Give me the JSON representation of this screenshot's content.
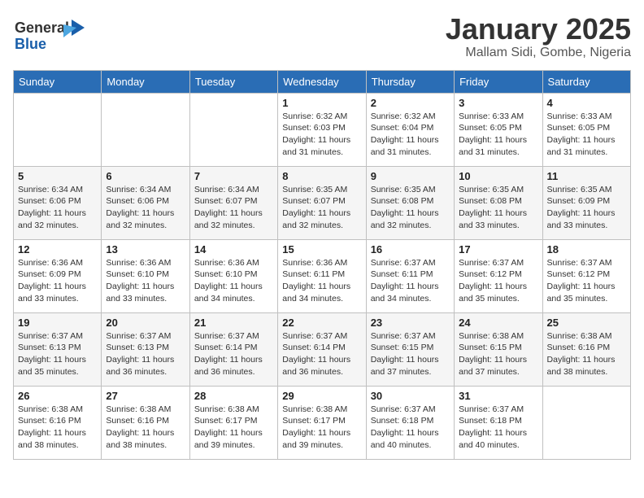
{
  "header": {
    "logo_general": "General",
    "logo_blue": "Blue",
    "month_title": "January 2025",
    "location": "Mallam Sidi, Gombe, Nigeria"
  },
  "weekdays": [
    "Sunday",
    "Monday",
    "Tuesday",
    "Wednesday",
    "Thursday",
    "Friday",
    "Saturday"
  ],
  "weeks": [
    [
      {
        "day": "",
        "sunrise": "",
        "sunset": "",
        "daylight": ""
      },
      {
        "day": "",
        "sunrise": "",
        "sunset": "",
        "daylight": ""
      },
      {
        "day": "",
        "sunrise": "",
        "sunset": "",
        "daylight": ""
      },
      {
        "day": "1",
        "sunrise": "Sunrise: 6:32 AM",
        "sunset": "Sunset: 6:03 PM",
        "daylight": "Daylight: 11 hours and 31 minutes."
      },
      {
        "day": "2",
        "sunrise": "Sunrise: 6:32 AM",
        "sunset": "Sunset: 6:04 PM",
        "daylight": "Daylight: 11 hours and 31 minutes."
      },
      {
        "day": "3",
        "sunrise": "Sunrise: 6:33 AM",
        "sunset": "Sunset: 6:05 PM",
        "daylight": "Daylight: 11 hours and 31 minutes."
      },
      {
        "day": "4",
        "sunrise": "Sunrise: 6:33 AM",
        "sunset": "Sunset: 6:05 PM",
        "daylight": "Daylight: 11 hours and 31 minutes."
      }
    ],
    [
      {
        "day": "5",
        "sunrise": "Sunrise: 6:34 AM",
        "sunset": "Sunset: 6:06 PM",
        "daylight": "Daylight: 11 hours and 32 minutes."
      },
      {
        "day": "6",
        "sunrise": "Sunrise: 6:34 AM",
        "sunset": "Sunset: 6:06 PM",
        "daylight": "Daylight: 11 hours and 32 minutes."
      },
      {
        "day": "7",
        "sunrise": "Sunrise: 6:34 AM",
        "sunset": "Sunset: 6:07 PM",
        "daylight": "Daylight: 11 hours and 32 minutes."
      },
      {
        "day": "8",
        "sunrise": "Sunrise: 6:35 AM",
        "sunset": "Sunset: 6:07 PM",
        "daylight": "Daylight: 11 hours and 32 minutes."
      },
      {
        "day": "9",
        "sunrise": "Sunrise: 6:35 AM",
        "sunset": "Sunset: 6:08 PM",
        "daylight": "Daylight: 11 hours and 32 minutes."
      },
      {
        "day": "10",
        "sunrise": "Sunrise: 6:35 AM",
        "sunset": "Sunset: 6:08 PM",
        "daylight": "Daylight: 11 hours and 33 minutes."
      },
      {
        "day": "11",
        "sunrise": "Sunrise: 6:35 AM",
        "sunset": "Sunset: 6:09 PM",
        "daylight": "Daylight: 11 hours and 33 minutes."
      }
    ],
    [
      {
        "day": "12",
        "sunrise": "Sunrise: 6:36 AM",
        "sunset": "Sunset: 6:09 PM",
        "daylight": "Daylight: 11 hours and 33 minutes."
      },
      {
        "day": "13",
        "sunrise": "Sunrise: 6:36 AM",
        "sunset": "Sunset: 6:10 PM",
        "daylight": "Daylight: 11 hours and 33 minutes."
      },
      {
        "day": "14",
        "sunrise": "Sunrise: 6:36 AM",
        "sunset": "Sunset: 6:10 PM",
        "daylight": "Daylight: 11 hours and 34 minutes."
      },
      {
        "day": "15",
        "sunrise": "Sunrise: 6:36 AM",
        "sunset": "Sunset: 6:11 PM",
        "daylight": "Daylight: 11 hours and 34 minutes."
      },
      {
        "day": "16",
        "sunrise": "Sunrise: 6:37 AM",
        "sunset": "Sunset: 6:11 PM",
        "daylight": "Daylight: 11 hours and 34 minutes."
      },
      {
        "day": "17",
        "sunrise": "Sunrise: 6:37 AM",
        "sunset": "Sunset: 6:12 PM",
        "daylight": "Daylight: 11 hours and 35 minutes."
      },
      {
        "day": "18",
        "sunrise": "Sunrise: 6:37 AM",
        "sunset": "Sunset: 6:12 PM",
        "daylight": "Daylight: 11 hours and 35 minutes."
      }
    ],
    [
      {
        "day": "19",
        "sunrise": "Sunrise: 6:37 AM",
        "sunset": "Sunset: 6:13 PM",
        "daylight": "Daylight: 11 hours and 35 minutes."
      },
      {
        "day": "20",
        "sunrise": "Sunrise: 6:37 AM",
        "sunset": "Sunset: 6:13 PM",
        "daylight": "Daylight: 11 hours and 36 minutes."
      },
      {
        "day": "21",
        "sunrise": "Sunrise: 6:37 AM",
        "sunset": "Sunset: 6:14 PM",
        "daylight": "Daylight: 11 hours and 36 minutes."
      },
      {
        "day": "22",
        "sunrise": "Sunrise: 6:37 AM",
        "sunset": "Sunset: 6:14 PM",
        "daylight": "Daylight: 11 hours and 36 minutes."
      },
      {
        "day": "23",
        "sunrise": "Sunrise: 6:37 AM",
        "sunset": "Sunset: 6:15 PM",
        "daylight": "Daylight: 11 hours and 37 minutes."
      },
      {
        "day": "24",
        "sunrise": "Sunrise: 6:38 AM",
        "sunset": "Sunset: 6:15 PM",
        "daylight": "Daylight: 11 hours and 37 minutes."
      },
      {
        "day": "25",
        "sunrise": "Sunrise: 6:38 AM",
        "sunset": "Sunset: 6:16 PM",
        "daylight": "Daylight: 11 hours and 38 minutes."
      }
    ],
    [
      {
        "day": "26",
        "sunrise": "Sunrise: 6:38 AM",
        "sunset": "Sunset: 6:16 PM",
        "daylight": "Daylight: 11 hours and 38 minutes."
      },
      {
        "day": "27",
        "sunrise": "Sunrise: 6:38 AM",
        "sunset": "Sunset: 6:16 PM",
        "daylight": "Daylight: 11 hours and 38 minutes."
      },
      {
        "day": "28",
        "sunrise": "Sunrise: 6:38 AM",
        "sunset": "Sunset: 6:17 PM",
        "daylight": "Daylight: 11 hours and 39 minutes."
      },
      {
        "day": "29",
        "sunrise": "Sunrise: 6:38 AM",
        "sunset": "Sunset: 6:17 PM",
        "daylight": "Daylight: 11 hours and 39 minutes."
      },
      {
        "day": "30",
        "sunrise": "Sunrise: 6:37 AM",
        "sunset": "Sunset: 6:18 PM",
        "daylight": "Daylight: 11 hours and 40 minutes."
      },
      {
        "day": "31",
        "sunrise": "Sunrise: 6:37 AM",
        "sunset": "Sunset: 6:18 PM",
        "daylight": "Daylight: 11 hours and 40 minutes."
      },
      {
        "day": "",
        "sunrise": "",
        "sunset": "",
        "daylight": ""
      }
    ]
  ]
}
